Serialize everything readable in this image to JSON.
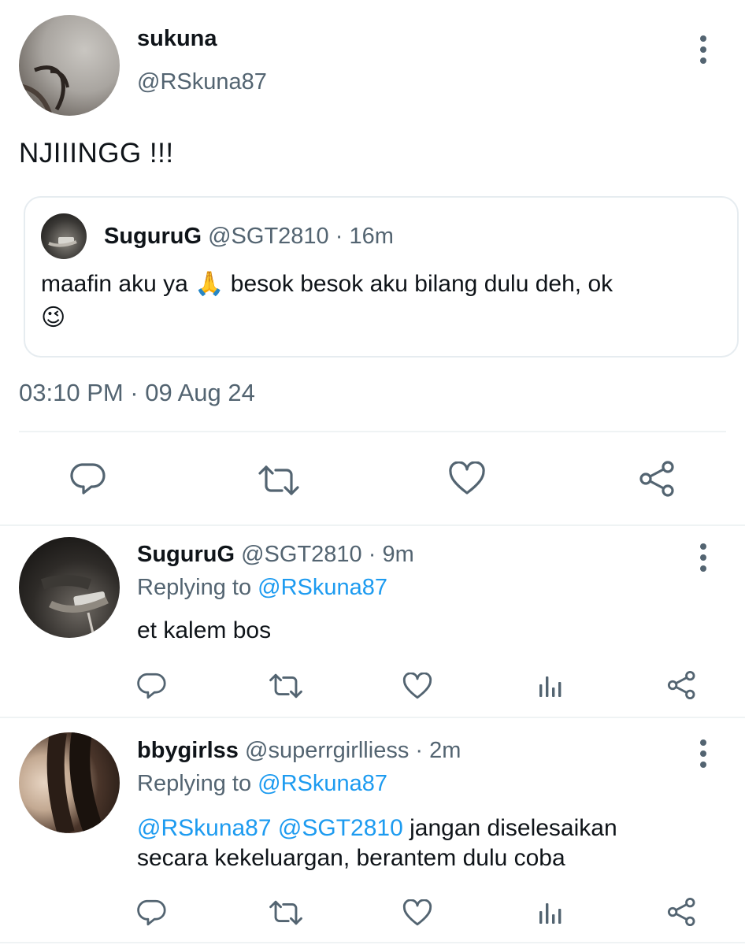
{
  "main_tweet": {
    "display_name": "sukuna",
    "handle": "@RSkuna87",
    "text": "NJIIINGG !!!",
    "timestamp": "03:10 PM · 09 Aug 24",
    "quoted": {
      "display_name": "SuguruG",
      "handle": "@SGT2810",
      "age": "· 16m",
      "text_part1": "maafin aku ya ",
      "emoji_pray": "🙏",
      "text_part2": " besok besok aku bilang dulu deh, ok",
      "emoji_wink": "😉"
    },
    "actions": [
      "reply-icon",
      "retweet-icon",
      "like-icon",
      "share-icon"
    ]
  },
  "replies": [
    {
      "display_name": "SuguruG",
      "handle": "@SGT2810",
      "age": "· 9m",
      "replying_label": "Replying to",
      "replying_to": "@RSkuna87",
      "text": "et kalem bos"
    },
    {
      "display_name": "bbygirlss",
      "handle": "@superrgirlliess",
      "age": "· 2m",
      "replying_label": "Replying to",
      "replying_to": "@RSkuna87",
      "mention1": "@RSkuna87",
      "mention2": "@SGT2810",
      "text_line1": " jangan diselesaikan",
      "text_line2": "secara kekeluargan, berantem dulu coba"
    }
  ],
  "colors": {
    "accent": "#1d9bf0",
    "secondary_text": "#536471",
    "divider": "#eff3f4"
  }
}
